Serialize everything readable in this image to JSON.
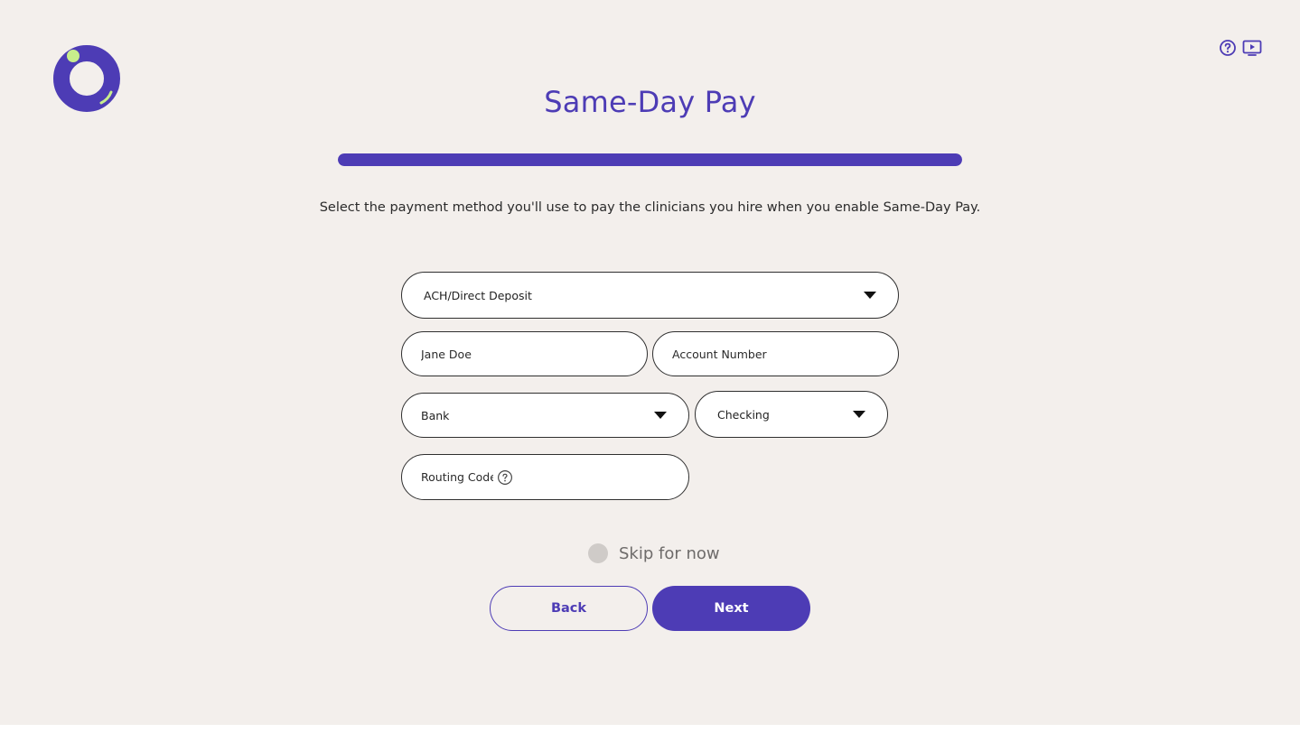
{
  "app": {
    "logo_icon": "circle-logo-icon",
    "top_icons": [
      "help-circle-icon",
      "video-play-icon"
    ],
    "brand_color": "#4d3cb5",
    "accent_color": "#c8ee8c"
  },
  "header": {
    "title": "Same-Day Pay",
    "progress_percent": 100,
    "subtitle": "Select the payment method you'll use to pay the clinicians you hire when you enable Same-Day Pay."
  },
  "form": {
    "payment_method": {
      "value": "ACH/Direct Deposit",
      "icon": "caret-down-icon"
    },
    "name": {
      "value": "",
      "placeholder": "Jane Doe"
    },
    "account_number": {
      "value": "",
      "placeholder": "Account Number"
    },
    "bank": {
      "value": "Bank",
      "icon": "caret-down-icon"
    },
    "account_type": {
      "value": "Checking",
      "icon": "caret-down-icon"
    },
    "routing_code": {
      "value": "",
      "placeholder": "Routing Code",
      "icon": "help-circle-icon"
    }
  },
  "skip": {
    "label": "Skip for now",
    "checked": false
  },
  "actions": {
    "back_label": "Back",
    "next_label": "Next"
  }
}
